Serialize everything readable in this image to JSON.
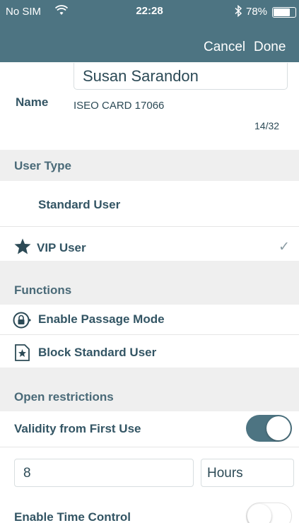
{
  "status_bar": {
    "carrier": "No SIM",
    "time": "22:28",
    "battery": "78%",
    "battery_level": 0.78
  },
  "nav": {
    "cancel_label": "Cancel",
    "done_label": "Done"
  },
  "user": {
    "name_label": "Name",
    "name_value": "Susan Sarandon",
    "card_id": "ISEO CARD 17066",
    "char_count": "14/32"
  },
  "user_type": {
    "header": "User Type",
    "options": [
      {
        "label": "Standard User",
        "selected": false
      },
      {
        "label": "VIP User",
        "selected": true,
        "icon": "star-icon"
      }
    ]
  },
  "functions": {
    "header": "Functions",
    "items": [
      {
        "label": "Enable Passage Mode",
        "icon": "passage-lock-icon"
      },
      {
        "label": "Block Standard User",
        "icon": "block-star-icon"
      }
    ]
  },
  "open_restrictions": {
    "header": "Open restrictions",
    "validity_label": "Validity from First Use",
    "validity_on": true,
    "duration_value": "8",
    "duration_unit": "Hours",
    "time_control_label": "Enable Time Control",
    "time_control_on": false
  },
  "colors": {
    "accent": "#4d7482",
    "section_bg": "#efefef",
    "text": "#335564"
  }
}
